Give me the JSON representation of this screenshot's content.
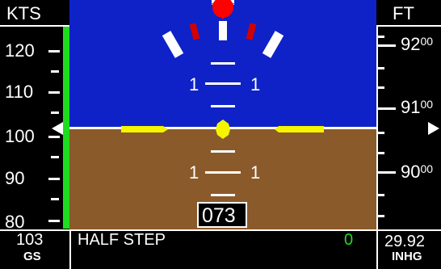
{
  "airspeed": {
    "unit": "KTS",
    "ticks": [
      "120",
      "110",
      "100",
      "90",
      "80"
    ],
    "current": "103",
    "current_label": "GS"
  },
  "altitude": {
    "unit": "FT",
    "ticks": [
      {
        "main": "92",
        "small": "00"
      },
      {
        "main": "91",
        "small": "00"
      },
      {
        "main": "90",
        "small": "00"
      }
    ],
    "baro": "29.92",
    "baro_unit": "INHG"
  },
  "attitude": {
    "pitch_upper_left": "1",
    "pitch_upper_right": "1",
    "pitch_lower_left": "1",
    "pitch_lower_right": "1",
    "heading": "073"
  },
  "status": {
    "message": "HALF STEP",
    "value": "0",
    "value_color": "#1edc1e"
  },
  "colors": {
    "sky": "#0e22c8",
    "ground": "#8b5a2b",
    "aircraft_symbol": "#f5f500",
    "bank_pointer": "#ff0000",
    "speed_trend": "#1edc1e"
  }
}
